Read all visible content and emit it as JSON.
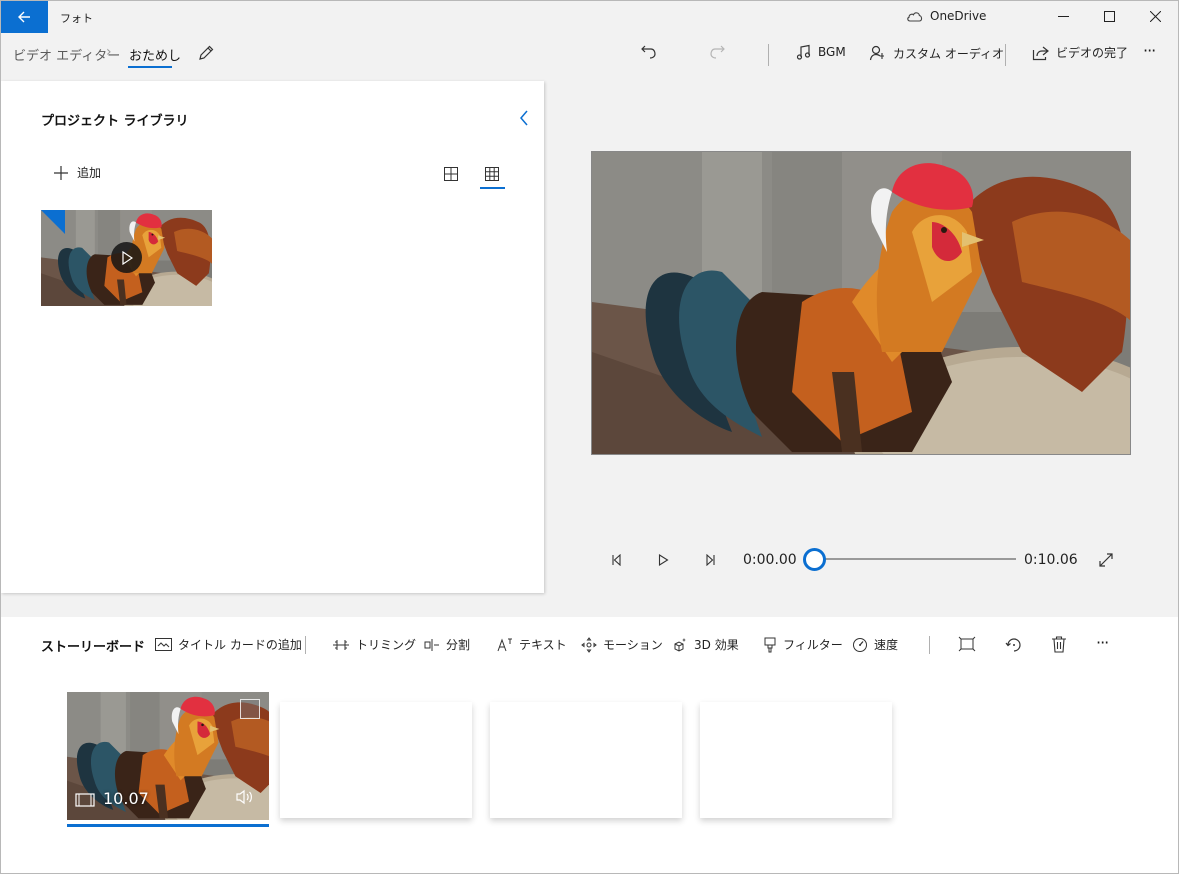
{
  "titlebar": {
    "app_title": "フォト",
    "onedrive_label": "OneDrive"
  },
  "toolbar": {
    "breadcrumb_parent": "ビデオ エディター",
    "breadcrumb_current": "おためし",
    "bgm_label": "BGM",
    "custom_audio_label": "カスタム オーディオ",
    "finish_video_label": "ビデオの完了",
    "more": "···"
  },
  "library": {
    "title": "プロジェクト ライブラリ",
    "add_label": "追加"
  },
  "playback": {
    "current_time": "0:00.00",
    "total_time": "0:10.06",
    "progress": 0
  },
  "storyboard": {
    "title": "ストーリーボード",
    "tools": [
      "タイトル カードの追加",
      "トリミング",
      "分割",
      "テキスト",
      "モーション",
      "3D 効果",
      "フィルター",
      "速度"
    ],
    "clip_duration": "10.07",
    "more": "···"
  },
  "colors": {
    "accent": "#0b6fd1",
    "panel": "#ffffff",
    "background": "#f2f2f2"
  }
}
